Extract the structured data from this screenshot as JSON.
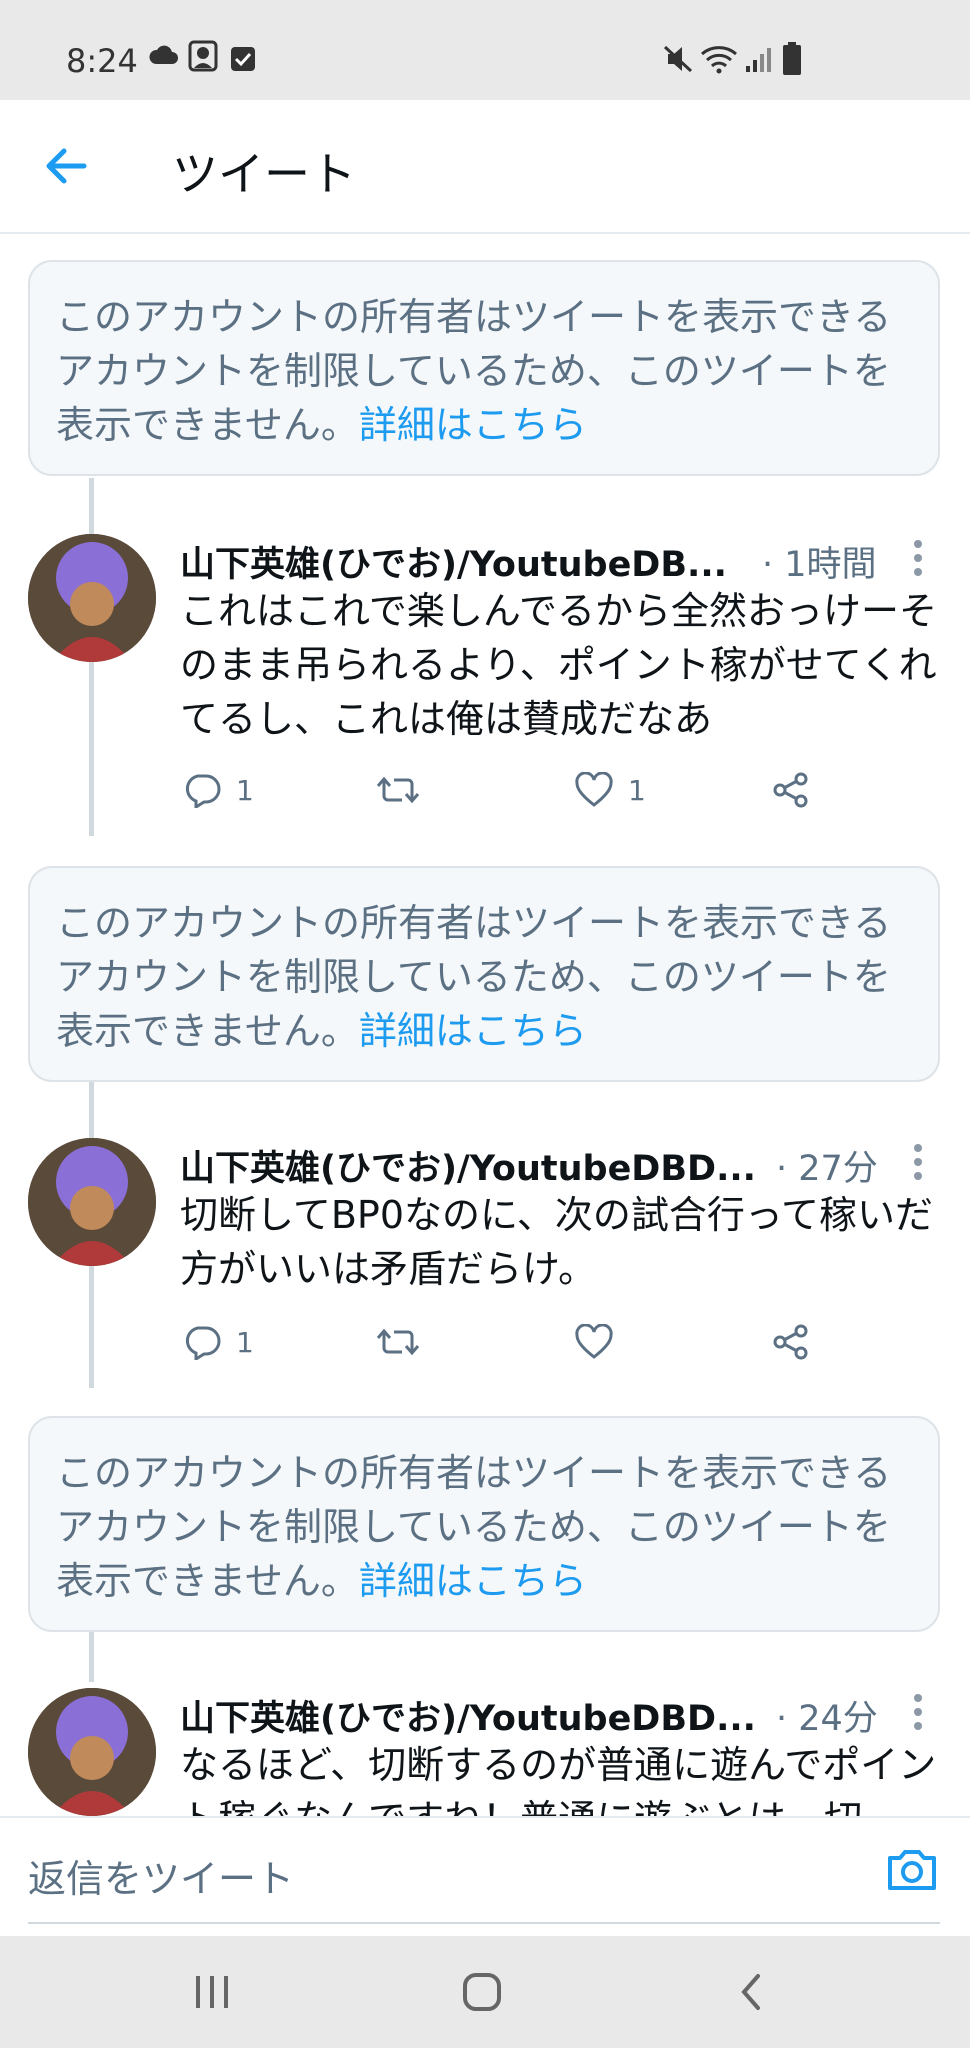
{
  "status_bar": {
    "time": "8:24",
    "icons": [
      "cloud-icon",
      "profile-photo-icon",
      "checkbox-icon",
      "mute-icon",
      "wifi-icon",
      "signal-icon",
      "battery-icon"
    ]
  },
  "header": {
    "title": "ツイート",
    "back_icon": "arrow-left-icon",
    "accent": "#1d9bf0"
  },
  "notice": {
    "text": "このアカウントの所有者はツイートを表示できるアカウントを制限しているため、このツイートを表示できません。",
    "link": "詳細はこちら"
  },
  "tweets": [
    {
      "name": "山下英雄(ひでお)/YoutubeDB...",
      "time": "· 1時間",
      "text": "これはこれで楽しんでるから全然おっけーそのまま吊られるより、ポイント稼がせてくれてるし、これは俺は賛成だなあ",
      "replies": "1",
      "retweets": "",
      "likes": "1"
    },
    {
      "name": "山下英雄(ひでお)/YoutubeDBD...",
      "time": "· 27分",
      "text": "切断してBP0なのに、次の試合行って稼いだ方がいいは矛盾だらけ。",
      "replies": "1",
      "retweets": "",
      "likes": ""
    },
    {
      "name": "山下英雄(ひでお)/YoutubeDBD...",
      "time": "· 24分",
      "text": "なるほど、切断するのが普通に遊んでポイント稼ぐなんですね！普通に遊ぶとは、切",
      "replies": "",
      "retweets": "",
      "likes": ""
    }
  ],
  "reply_bar": {
    "placeholder": "返信をツイート"
  },
  "nav_bar": {
    "buttons": [
      "recent-apps-icon",
      "home-icon",
      "back-icon"
    ]
  }
}
